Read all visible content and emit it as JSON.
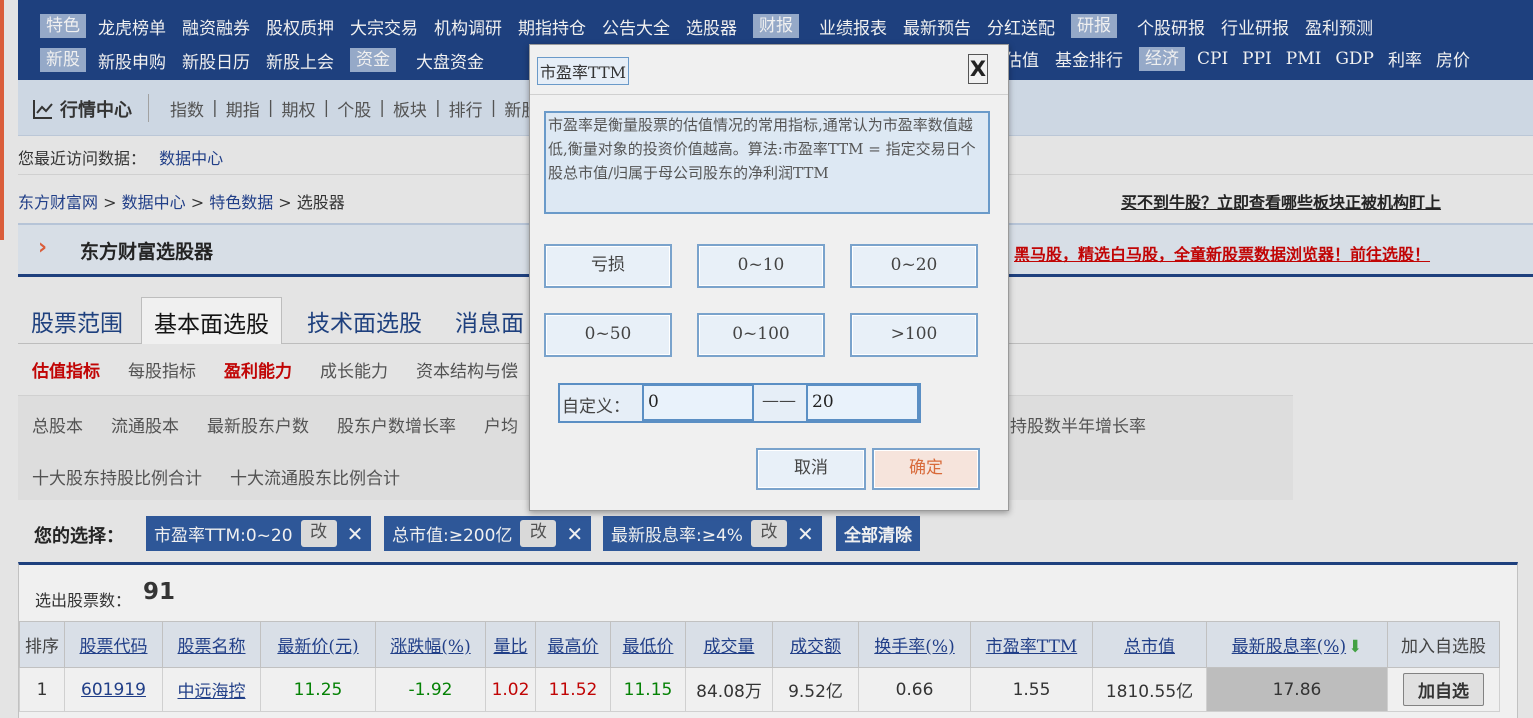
{
  "topnav": {
    "row1": [
      {
        "tag": "特色",
        "items": [
          "龙虎榜单",
          "融资融券",
          "股权质押",
          "大宗交易",
          "机构调研",
          "期指持仓",
          "公告大全",
          "选股器"
        ]
      },
      {
        "tag": "财报",
        "items": [
          "业绩报表",
          "最新预告",
          "分红送配"
        ]
      },
      {
        "tag": "研报",
        "items": [
          "个股研报",
          "行业研报",
          "盈利预测"
        ]
      }
    ],
    "row2": [
      {
        "tag": "新股",
        "items": [
          "新股申购",
          "新股日历",
          "新股上会"
        ]
      },
      {
        "tag": "资金",
        "items": [
          "大盘资金"
        ]
      },
      {
        "tag": "",
        "items": [
          "估值",
          "基金排行"
        ]
      },
      {
        "tag": "经济",
        "items": [
          "CPI",
          "PPI",
          "PMI",
          "GDP",
          "利率",
          "房价"
        ]
      }
    ]
  },
  "subnav": {
    "title": "行情中心",
    "items": [
      "指数",
      "期指",
      "期权",
      "个股",
      "板块",
      "排行",
      "新股"
    ]
  },
  "recent": {
    "label": "您最近访问数据：",
    "link": "数据中心"
  },
  "breadcrumb": {
    "items": [
      "东方财富网",
      "数据中心",
      "特色数据",
      "选股器"
    ],
    "sep": " > "
  },
  "promo_top": "买不到牛股？立即查看哪些板块正被机构盯上",
  "selector": {
    "title": "东方财富选股器",
    "promo": "黑马股，精选白马股，全童新股票数据浏览器！前往选股！"
  },
  "tabs": [
    "股票范围",
    "基本面选股",
    "技术面选股",
    "消息面"
  ],
  "subtabs": [
    "估值指标",
    "每股指标",
    "盈利能力",
    "成长能力",
    "资本结构与偿"
  ],
  "attrs": {
    "row1": [
      "总股本",
      "流通股本",
      "最新股东户数",
      "股东户数增长率",
      "户均"
    ],
    "row1_right": "持股数半年增长率",
    "row2": [
      "十大股东持股比例合计",
      "十大流通股东比例合计"
    ]
  },
  "selection": {
    "label": "您的选择：",
    "chips": [
      {
        "text": "市盈率TTM:0~20",
        "edit": "改"
      },
      {
        "text": "总市值:≥200亿",
        "edit": "改"
      },
      {
        "text": "最新股息率:≥4%",
        "edit": "改"
      }
    ],
    "clear_all": "全部清除"
  },
  "result": {
    "label": "选出股票数：",
    "count": "91"
  },
  "table": {
    "headers": [
      "排序",
      "股票代码",
      "股票名称",
      "最新价(元)",
      "涨跌幅(%)",
      "量比",
      "最高价",
      "最低价",
      "成交量",
      "成交额",
      "换手率(%)",
      "市盈率TTM",
      "总市值",
      "最新股息率(%)",
      "加入自选股"
    ],
    "rows": [
      {
        "rank": "1",
        "code": "601919",
        "name": "中远海控",
        "price": "11.25",
        "change": "-1.92",
        "vr": "1.02",
        "high": "11.52",
        "low": "11.15",
        "vol": "84.08万",
        "amt": "9.52亿",
        "turn": "0.66",
        "pe": "1.55",
        "cap": "1810.55亿",
        "dy": "17.86",
        "add": "加自选"
      }
    ]
  },
  "modal": {
    "title": "市盈率TTM",
    "close": "X",
    "description": "市盈率是衡量股票的估值情况的常用指标,通常认为市盈率数值越低,衡量对象的投资价值越高。算法:市盈率TTM = 指定交易日个股总市值/归属于母公司股东的净利润TTM",
    "options": [
      "亏损",
      "0~10",
      "0~20",
      "0~50",
      "0~100",
      ">100"
    ],
    "custom_label": "自定义：",
    "custom_min": "0",
    "custom_sep": "——",
    "custom_max": "20",
    "cancel": "取消",
    "confirm": "确定"
  },
  "colors": {
    "nav": "#1c4184",
    "accent_red": "#c00",
    "positive": "#c00",
    "negative": "#080"
  }
}
